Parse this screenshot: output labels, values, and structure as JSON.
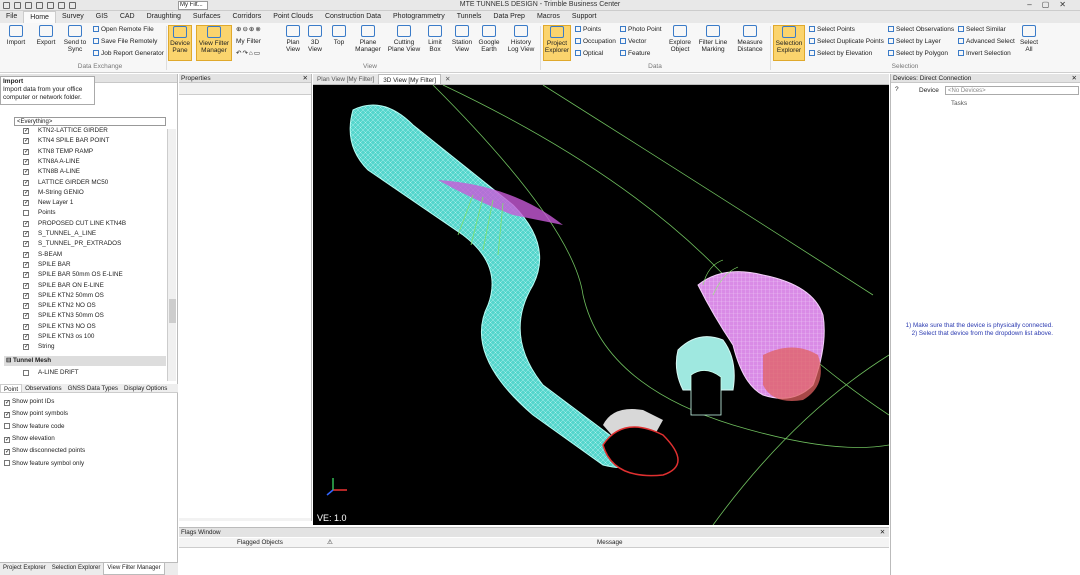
{
  "window": {
    "title": "MTE TUNNELS DESIGN - Trimble Business Center",
    "filter_combo": "My Filt..."
  },
  "tabs": [
    "File",
    "Home",
    "Survey",
    "GIS",
    "CAD",
    "Draughting",
    "Surfaces",
    "Corridors",
    "Point Clouds",
    "Construction Data",
    "Photogrammetry",
    "Tunnels",
    "Data Prep",
    "Macros",
    "Support"
  ],
  "ribbon": {
    "import": "Import",
    "export": "Export",
    "send_to_sync": "Send to Sync",
    "open_remote_file": "Open Remote File",
    "save_file_remotely": "Save File Remotely",
    "job_report_generator": "Job Report Generator",
    "group_data_exchange": "Data Exchange",
    "device_pane": "Device Pane",
    "view_filter_manager": "View Filter Manager",
    "my_filter": "My Filter",
    "plan_view": "Plan View",
    "view_3d": "3D View",
    "top": "Top",
    "plane_manager": "Plane Manager",
    "cutting_plane_view": "Cutting Plane View",
    "limit_box": "Limit Box",
    "station_view": "Station View",
    "google_earth": "Google Earth",
    "history_log_view": "History Log View",
    "group_view": "View",
    "project_explorer": "Project Explorer",
    "points": "Points",
    "occupation": "Occupation",
    "optical": "Optical",
    "photo_point": "Photo Point",
    "vector": "Vector",
    "feature": "Feature",
    "explore_object": "Explore Object",
    "filter_line_marking": "Filter Line Marking",
    "measure_distance": "Measure Distance",
    "group_data": "Data",
    "selection_explorer": "Selection Explorer",
    "select_points": "Select Points",
    "select_duplicate_points": "Select Duplicate Points",
    "select_by_elevation": "Select by Elevation",
    "select_observations": "Select Observations",
    "select_by_layer": "Select by Layer",
    "select_by_polygon": "Select by Polygon",
    "select_similar": "Select Similar",
    "advanced_select": "Advanced Select",
    "invert_selection": "Invert Selection",
    "select_all": "Select All",
    "group_selection": "Selection"
  },
  "tooltip": {
    "title": "Import",
    "body": "Import data from your office computer or network folder."
  },
  "left_panel": {
    "everything": "<Everything>",
    "layers": [
      {
        "label": "KTN2-LATTICE GIRDER",
        "checked": true
      },
      {
        "label": "KTN4 SPILE BAR POINT",
        "checked": true
      },
      {
        "label": "KTN8 TEMP RAMP",
        "checked": true
      },
      {
        "label": "KTN8A A-LINE",
        "checked": true
      },
      {
        "label": "KTN8B A-LINE",
        "checked": true
      },
      {
        "label": "LATTICE GIRDER MC50",
        "checked": true
      },
      {
        "label": "M-String GENIO",
        "checked": true
      },
      {
        "label": "New Layer 1",
        "checked": true
      },
      {
        "label": "Points",
        "checked": false
      },
      {
        "label": "PROPOSED CUT LINE KTN4B",
        "checked": true
      },
      {
        "label": "S_TUNNEL_A_LINE",
        "checked": true
      },
      {
        "label": "S_TUNNEL_PR_EXTRADOS",
        "checked": true
      },
      {
        "label": "S-BEAM",
        "checked": true
      },
      {
        "label": "SPILE BAR",
        "checked": true
      },
      {
        "label": "SPILE BAR 50mm OS E-LINE",
        "checked": true
      },
      {
        "label": "SPILE BAR ON E-LINE",
        "checked": true
      },
      {
        "label": "SPILE KTN2 50mm OS",
        "checked": true
      },
      {
        "label": "SPILE KTN2 NO OS",
        "checked": true
      },
      {
        "label": "SPILE KTN3 50mm OS",
        "checked": true
      },
      {
        "label": "SPILE KTN3 NO OS",
        "checked": true
      },
      {
        "label": "SPILE KTN3 os 100",
        "checked": true
      },
      {
        "label": "String",
        "checked": true
      }
    ],
    "tunnel_mesh": "Tunnel Mesh",
    "aline_drift": "A-LINE DRIFT",
    "prop_tabs": [
      "Point",
      "Observations",
      "GNSS Data Types",
      "Display Options"
    ],
    "options": [
      {
        "label": "Show point IDs",
        "checked": true
      },
      {
        "label": "Show point symbols",
        "checked": true
      },
      {
        "label": "Show feature code",
        "checked": false
      },
      {
        "label": "Show elevation",
        "checked": true
      },
      {
        "label": "Show disconnected points",
        "checked": true
      },
      {
        "label": "Show feature symbol only",
        "checked": false
      }
    ],
    "bottom_tabs": [
      "Project Explorer",
      "Selection Explorer",
      "View Filter Manager"
    ]
  },
  "properties": {
    "title": "Properties"
  },
  "view_tabs": [
    "Plan View [My Filter]",
    "3D View [My Filter]"
  ],
  "viewport": {
    "ve": "VE: 1.0"
  },
  "flags": {
    "title": "Flags Window",
    "col_flagged": "Flagged Objects",
    "col_message": "Message"
  },
  "devices": {
    "title": "Devices: Direct Connection",
    "device_label": "Device",
    "device_value": "<No Devices>",
    "tasks": "Tasks",
    "msg1": "1) Make sure that the device is physically connected.",
    "msg2": "2) Select that device from the dropdown list above."
  }
}
